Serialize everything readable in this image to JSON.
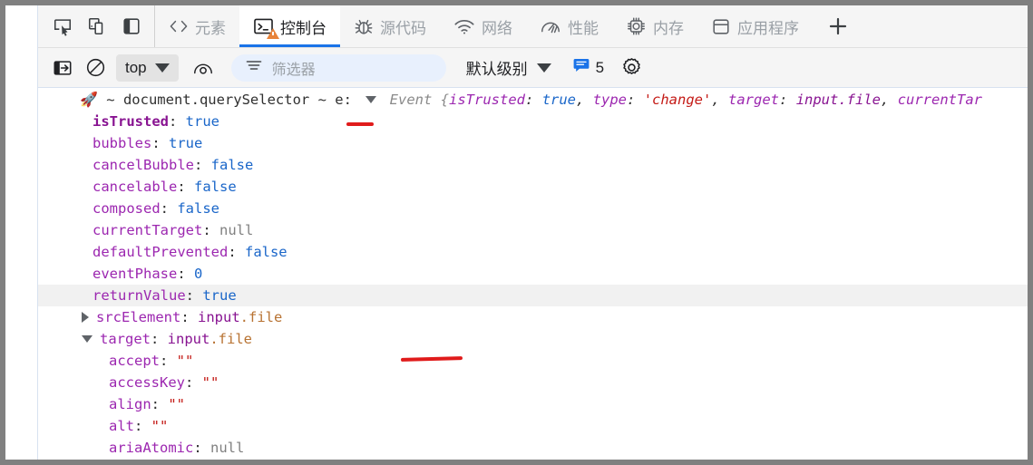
{
  "window": {
    "title": "Chrome DevTools - Console"
  },
  "toolbar_left": {
    "inspect_icon": "inspect-element-icon",
    "device_icon": "device-toolbar-icon",
    "panel_icon": "dock-side-panel-icon"
  },
  "tabs": [
    {
      "id": "elements",
      "label": "元素",
      "icon": "code-brackets-icon",
      "active": false,
      "badge": null
    },
    {
      "id": "console",
      "label": "控制台",
      "icon": "console-terminal-icon",
      "active": true,
      "badge": "warning"
    },
    {
      "id": "sources",
      "label": "源代码",
      "icon": "bug-sources-icon",
      "active": false,
      "badge": null
    },
    {
      "id": "network",
      "label": "网络",
      "icon": "wifi-network-icon",
      "active": false,
      "badge": null
    },
    {
      "id": "performance",
      "label": "性能",
      "icon": "gauge-performance-icon",
      "active": false,
      "badge": null
    },
    {
      "id": "memory",
      "label": "内存",
      "icon": "memory-chip-icon",
      "active": false,
      "badge": null
    },
    {
      "id": "application",
      "label": "应用程序",
      "icon": "application-storage-icon",
      "active": false,
      "badge": null
    }
  ],
  "add_tab": {
    "label": "+",
    "icon": "plus-icon"
  },
  "console_toolbar": {
    "sidebar_toggle_icon": "console-sidebar-toggle-icon",
    "clear_icon": "clear-console-icon",
    "context": {
      "value": "top",
      "caret": "▼"
    },
    "live_expression_icon": "eye-live-expression-icon",
    "filter": {
      "icon": "filter-lines-icon",
      "placeholder": "筛选器",
      "value": ""
    },
    "level": {
      "value": "默认级别",
      "caret": "▼"
    },
    "issues": {
      "icon": "issues-speech-bubble-icon",
      "count": "5"
    },
    "settings_icon": "gear-settings-icon"
  },
  "console_log": {
    "header": {
      "source_icon": "rocket-emoji",
      "prefix_1": "~",
      "prefix_2": "document.querySelector",
      "prefix_3": "~",
      "var_name": "e:",
      "expander": "▼",
      "object_type": "Event",
      "open_brace": "{",
      "preview": [
        {
          "key": "isTrusted",
          "sep": ": ",
          "value": "true",
          "value_kind": "bool",
          "comma": ", "
        },
        {
          "key": "type",
          "sep": ": ",
          "value": "'change'",
          "value_kind": "str",
          "comma": ", "
        },
        {
          "key": "target",
          "sep": ": ",
          "value": "input.file",
          "value_kind": "obj",
          "comma": ", "
        },
        {
          "key": "currentTar",
          "sep": "",
          "value": "",
          "value_kind": "none",
          "comma": ""
        }
      ]
    },
    "properties": [
      {
        "expander": "none",
        "key": "isTrusted",
        "value": "true",
        "kind": "bool",
        "own": true,
        "indent": 2,
        "highlight": false
      },
      {
        "expander": "none",
        "key": "bubbles",
        "value": "true",
        "kind": "bool",
        "own": false,
        "indent": 2,
        "highlight": false
      },
      {
        "expander": "none",
        "key": "cancelBubble",
        "value": "false",
        "kind": "bool",
        "own": false,
        "indent": 2,
        "highlight": false
      },
      {
        "expander": "none",
        "key": "cancelable",
        "value": "false",
        "kind": "bool",
        "own": false,
        "indent": 2,
        "highlight": false
      },
      {
        "expander": "none",
        "key": "composed",
        "value": "false",
        "kind": "bool",
        "own": false,
        "indent": 2,
        "highlight": false
      },
      {
        "expander": "none",
        "key": "currentTarget",
        "value": "null",
        "kind": "null",
        "own": false,
        "indent": 2,
        "highlight": false
      },
      {
        "expander": "none",
        "key": "defaultPrevented",
        "value": "false",
        "kind": "bool",
        "own": false,
        "indent": 2,
        "highlight": false
      },
      {
        "expander": "none",
        "key": "eventPhase",
        "value": "0",
        "kind": "num",
        "own": false,
        "indent": 2,
        "highlight": false
      },
      {
        "expander": "none",
        "key": "returnValue",
        "value": "true",
        "kind": "bool",
        "own": false,
        "indent": 2,
        "highlight": true
      },
      {
        "expander": "right",
        "key": "srcElement",
        "value": "input.file",
        "kind": "obj",
        "own": false,
        "indent": 1,
        "highlight": false
      },
      {
        "expander": "down",
        "key": "target",
        "value": "input.file",
        "kind": "obj",
        "own": false,
        "indent": 1,
        "highlight": false
      },
      {
        "expander": "none",
        "key": "accept",
        "value": "\"\"",
        "kind": "str",
        "own": false,
        "indent": 3,
        "highlight": false
      },
      {
        "expander": "none",
        "key": "accessKey",
        "value": "\"\"",
        "kind": "str",
        "own": false,
        "indent": 3,
        "highlight": false
      },
      {
        "expander": "none",
        "key": "align",
        "value": "\"\"",
        "kind": "str",
        "own": false,
        "indent": 3,
        "highlight": false
      },
      {
        "expander": "none",
        "key": "alt",
        "value": "\"\"",
        "kind": "str",
        "own": false,
        "indent": 3,
        "highlight": false
      },
      {
        "expander": "none",
        "key": "ariaAtomic",
        "value": "null",
        "kind": "null",
        "own": false,
        "indent": 3,
        "highlight": false
      }
    ]
  },
  "annotations": [
    {
      "id": "annot-1",
      "type": "red-underline",
      "target": "e-variable"
    },
    {
      "id": "annot-2",
      "type": "red-underline",
      "target": "target-property"
    }
  ],
  "colors": {
    "accent": "#1a73e8",
    "warning": "#e8833a",
    "annotation": "#e01b1b",
    "filter_bg": "#e8f0fd",
    "highlight_row": "#f1f1f1",
    "toolbar_bg": "#f5f5f5"
  }
}
